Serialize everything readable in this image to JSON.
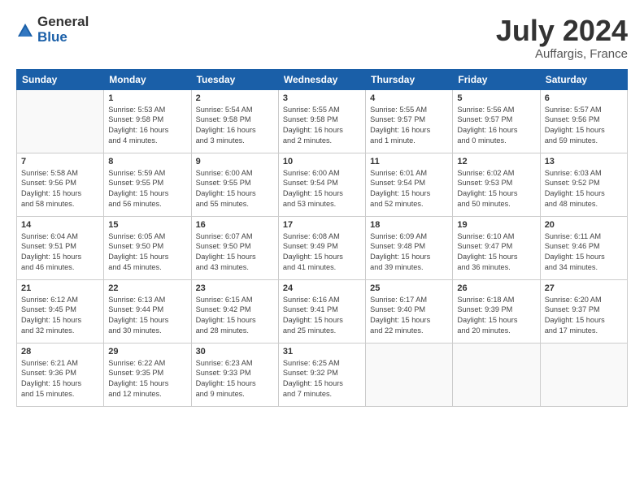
{
  "header": {
    "logo_general": "General",
    "logo_blue": "Blue",
    "month_title": "July 2024",
    "location": "Auffargis, France"
  },
  "weekdays": [
    "Sunday",
    "Monday",
    "Tuesday",
    "Wednesday",
    "Thursday",
    "Friday",
    "Saturday"
  ],
  "weeks": [
    [
      {
        "day": "",
        "info": ""
      },
      {
        "day": "1",
        "info": "Sunrise: 5:53 AM\nSunset: 9:58 PM\nDaylight: 16 hours\nand 4 minutes."
      },
      {
        "day": "2",
        "info": "Sunrise: 5:54 AM\nSunset: 9:58 PM\nDaylight: 16 hours\nand 3 minutes."
      },
      {
        "day": "3",
        "info": "Sunrise: 5:55 AM\nSunset: 9:58 PM\nDaylight: 16 hours\nand 2 minutes."
      },
      {
        "day": "4",
        "info": "Sunrise: 5:55 AM\nSunset: 9:57 PM\nDaylight: 16 hours\nand 1 minute."
      },
      {
        "day": "5",
        "info": "Sunrise: 5:56 AM\nSunset: 9:57 PM\nDaylight: 16 hours\nand 0 minutes."
      },
      {
        "day": "6",
        "info": "Sunrise: 5:57 AM\nSunset: 9:56 PM\nDaylight: 15 hours\nand 59 minutes."
      }
    ],
    [
      {
        "day": "7",
        "info": "Sunrise: 5:58 AM\nSunset: 9:56 PM\nDaylight: 15 hours\nand 58 minutes."
      },
      {
        "day": "8",
        "info": "Sunrise: 5:59 AM\nSunset: 9:55 PM\nDaylight: 15 hours\nand 56 minutes."
      },
      {
        "day": "9",
        "info": "Sunrise: 6:00 AM\nSunset: 9:55 PM\nDaylight: 15 hours\nand 55 minutes."
      },
      {
        "day": "10",
        "info": "Sunrise: 6:00 AM\nSunset: 9:54 PM\nDaylight: 15 hours\nand 53 minutes."
      },
      {
        "day": "11",
        "info": "Sunrise: 6:01 AM\nSunset: 9:54 PM\nDaylight: 15 hours\nand 52 minutes."
      },
      {
        "day": "12",
        "info": "Sunrise: 6:02 AM\nSunset: 9:53 PM\nDaylight: 15 hours\nand 50 minutes."
      },
      {
        "day": "13",
        "info": "Sunrise: 6:03 AM\nSunset: 9:52 PM\nDaylight: 15 hours\nand 48 minutes."
      }
    ],
    [
      {
        "day": "14",
        "info": "Sunrise: 6:04 AM\nSunset: 9:51 PM\nDaylight: 15 hours\nand 46 minutes."
      },
      {
        "day": "15",
        "info": "Sunrise: 6:05 AM\nSunset: 9:50 PM\nDaylight: 15 hours\nand 45 minutes."
      },
      {
        "day": "16",
        "info": "Sunrise: 6:07 AM\nSunset: 9:50 PM\nDaylight: 15 hours\nand 43 minutes."
      },
      {
        "day": "17",
        "info": "Sunrise: 6:08 AM\nSunset: 9:49 PM\nDaylight: 15 hours\nand 41 minutes."
      },
      {
        "day": "18",
        "info": "Sunrise: 6:09 AM\nSunset: 9:48 PM\nDaylight: 15 hours\nand 39 minutes."
      },
      {
        "day": "19",
        "info": "Sunrise: 6:10 AM\nSunset: 9:47 PM\nDaylight: 15 hours\nand 36 minutes."
      },
      {
        "day": "20",
        "info": "Sunrise: 6:11 AM\nSunset: 9:46 PM\nDaylight: 15 hours\nand 34 minutes."
      }
    ],
    [
      {
        "day": "21",
        "info": "Sunrise: 6:12 AM\nSunset: 9:45 PM\nDaylight: 15 hours\nand 32 minutes."
      },
      {
        "day": "22",
        "info": "Sunrise: 6:13 AM\nSunset: 9:44 PM\nDaylight: 15 hours\nand 30 minutes."
      },
      {
        "day": "23",
        "info": "Sunrise: 6:15 AM\nSunset: 9:42 PM\nDaylight: 15 hours\nand 28 minutes."
      },
      {
        "day": "24",
        "info": "Sunrise: 6:16 AM\nSunset: 9:41 PM\nDaylight: 15 hours\nand 25 minutes."
      },
      {
        "day": "25",
        "info": "Sunrise: 6:17 AM\nSunset: 9:40 PM\nDaylight: 15 hours\nand 22 minutes."
      },
      {
        "day": "26",
        "info": "Sunrise: 6:18 AM\nSunset: 9:39 PM\nDaylight: 15 hours\nand 20 minutes."
      },
      {
        "day": "27",
        "info": "Sunrise: 6:20 AM\nSunset: 9:37 PM\nDaylight: 15 hours\nand 17 minutes."
      }
    ],
    [
      {
        "day": "28",
        "info": "Sunrise: 6:21 AM\nSunset: 9:36 PM\nDaylight: 15 hours\nand 15 minutes."
      },
      {
        "day": "29",
        "info": "Sunrise: 6:22 AM\nSunset: 9:35 PM\nDaylight: 15 hours\nand 12 minutes."
      },
      {
        "day": "30",
        "info": "Sunrise: 6:23 AM\nSunset: 9:33 PM\nDaylight: 15 hours\nand 9 minutes."
      },
      {
        "day": "31",
        "info": "Sunrise: 6:25 AM\nSunset: 9:32 PM\nDaylight: 15 hours\nand 7 minutes."
      },
      {
        "day": "",
        "info": ""
      },
      {
        "day": "",
        "info": ""
      },
      {
        "day": "",
        "info": ""
      }
    ]
  ]
}
